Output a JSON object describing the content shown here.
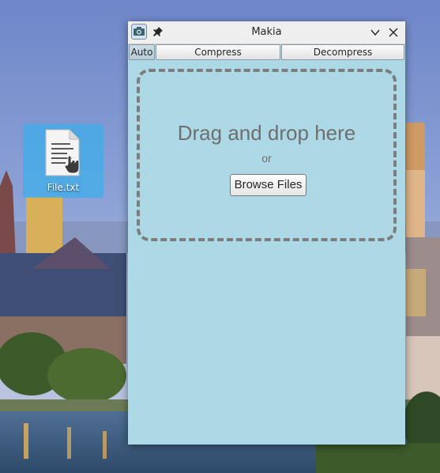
{
  "desktop": {
    "file_icon": {
      "label": "File.txt",
      "icon": "text-file-icon",
      "selected": true
    }
  },
  "window": {
    "title": "Makia",
    "app_icon": "camera-icon",
    "pin_icon": "pin-icon",
    "minimize_icon": "chevron-down-icon",
    "close_icon": "close-icon",
    "toolbar": {
      "auto_label": "Auto",
      "compress_label": "Compress",
      "decompress_label": "Decompress"
    },
    "dropzone": {
      "title": "Drag and drop here",
      "or_text": "or",
      "browse_label": "Browse Files"
    },
    "colors": {
      "background": "#add8e6",
      "dashed_border": "#7d7d7d",
      "titlebar": "#efefef"
    }
  }
}
